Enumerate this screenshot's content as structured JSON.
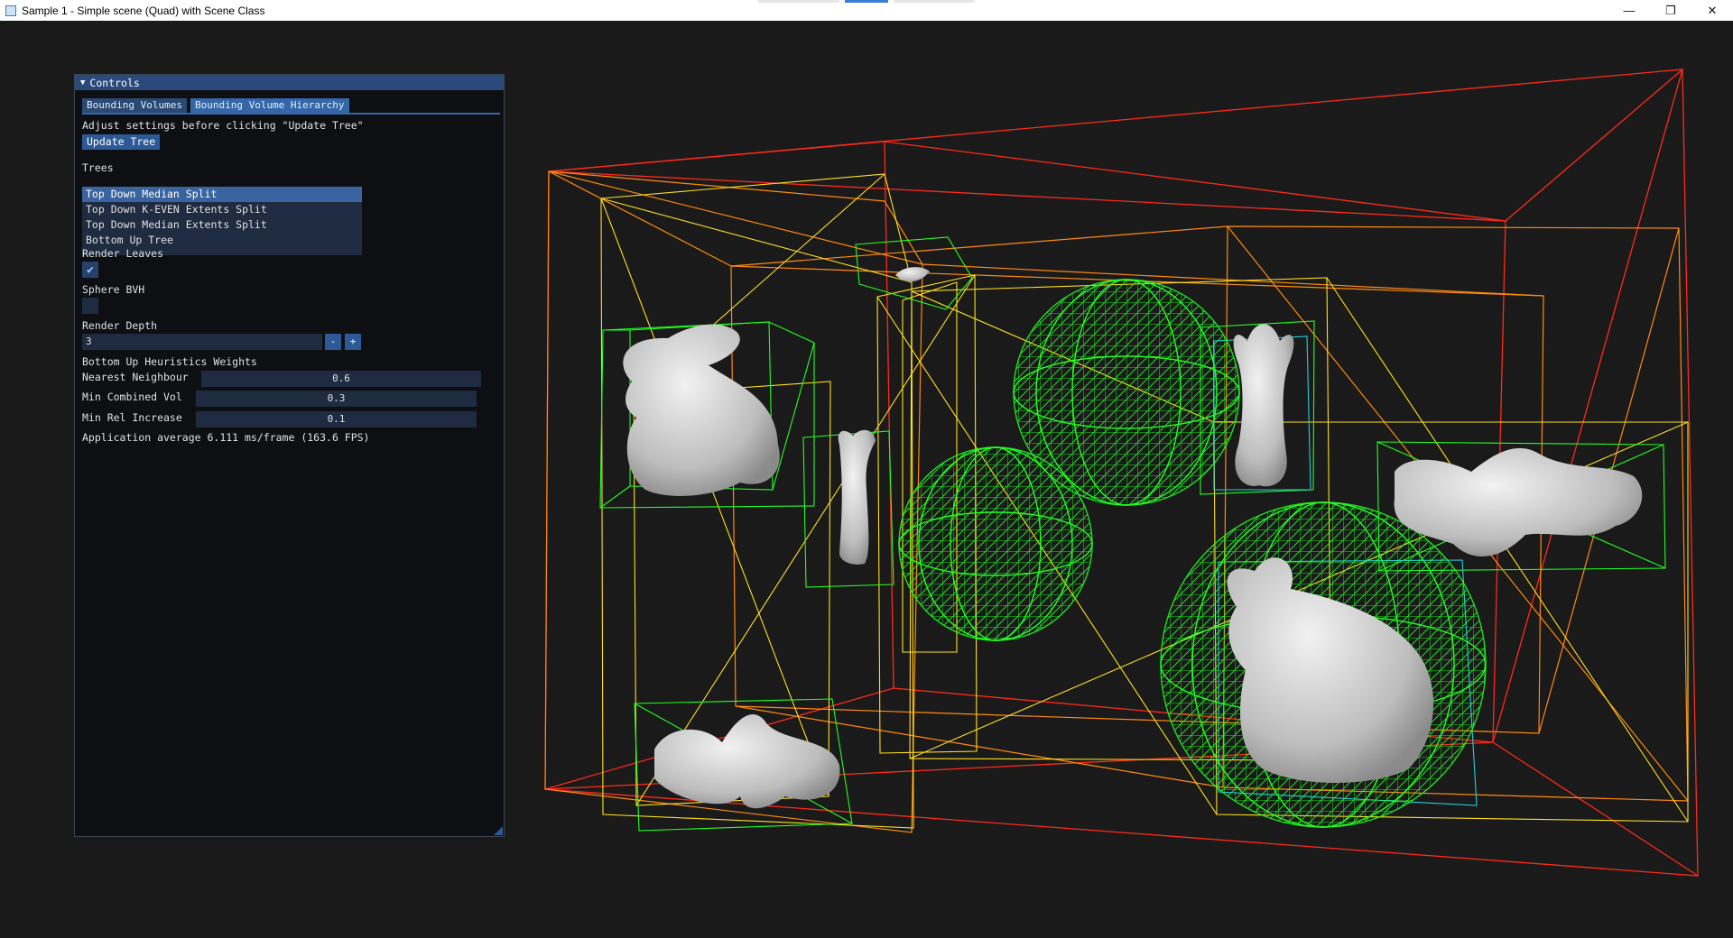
{
  "window": {
    "title": "Sample 1 - Simple scene (Quad) with Scene Class",
    "minimize": "—",
    "restore": "❐",
    "close": "✕"
  },
  "panel": {
    "title": "Controls",
    "tabs": [
      "Bounding Volumes",
      "Bounding Volume Hierarchy"
    ],
    "hint": "Adjust settings before clicking \"Update Tree\"",
    "update_button": "Update Tree",
    "trees_label": "Trees",
    "trees": [
      "Top Down Median Split",
      "Top Down K-EVEN Extents Split",
      "Top Down Median Extents Split",
      "Bottom Up Tree"
    ],
    "selected_tree": "Top Down Median Split",
    "render_leaves_label": "Render Leaves",
    "render_leaves": true,
    "sphere_bvh_label": "Sphere BVH",
    "sphere_bvh": false,
    "render_depth_label": "Render Depth",
    "render_depth": "3",
    "minus": "-",
    "plus": "+",
    "heuristics_label": "Bottom Up Heuristics Weights",
    "weights": [
      {
        "label": "Nearest Neighbour",
        "value": "0.6"
      },
      {
        "label": "Min Combined Vol",
        "value": "0.3"
      },
      {
        "label": "Min Rel Increase",
        "value": "0.1"
      }
    ],
    "fps_text": "Application average 6.111 ms/frame (163.6 FPS)"
  },
  "colors": {
    "level0": "#ff2a1a",
    "level1": "#ff8a10",
    "level2": "#ffe020",
    "leaf": "#22ff22",
    "leaf_inner": "#22d0e0",
    "mesh": "#e4e4e4"
  }
}
